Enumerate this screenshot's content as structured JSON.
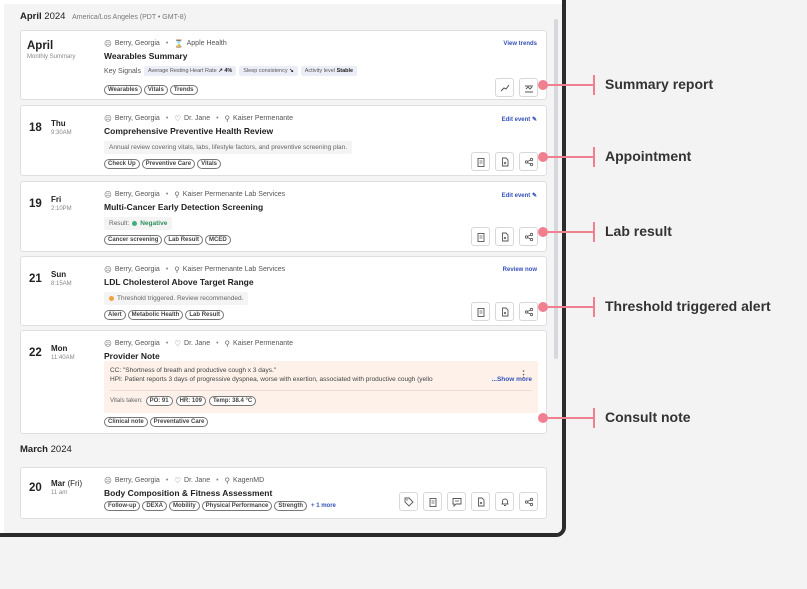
{
  "timezone": "America/Los Angeles (PDT • GMT-8)",
  "months": [
    {
      "name": "April",
      "year": "2024"
    },
    {
      "name": "March",
      "year": "2024"
    }
  ],
  "summary": {
    "month": "April",
    "subtitle": "Monthly Summary",
    "patient": "Berry, Georgia",
    "source": "Apple Health",
    "title": "Wearables Summary",
    "action": "View trends",
    "signals_label": "Key Signals",
    "signals": [
      {
        "label": "Average Resting Heart Rate",
        "value": "4%",
        "trend": "up"
      },
      {
        "label": "Sleep consistency",
        "value": "",
        "trend": "down"
      },
      {
        "label": "Activity level",
        "value": "Stable",
        "trend": "none"
      }
    ],
    "tags": [
      "Wearables",
      "Vitals",
      "Trends"
    ]
  },
  "appointment": {
    "day": "18",
    "weekday": "Thu",
    "time": "9:30AM",
    "patient": "Berry, Georgia",
    "provider": "Dr. Jane",
    "location": "Kaiser Permenante",
    "title": "Comprehensive Preventive Health Review",
    "description": "Annual review covering vitals, labs, lifestyle factors, and preventive screening plan.",
    "action": "Edit event",
    "tags": [
      "Check Up",
      "Preventive Care",
      "Vitals"
    ]
  },
  "lab": {
    "day": "19",
    "weekday": "Fri",
    "time": "2:10PM",
    "patient": "Berry, Georgia",
    "location": "Kaiser Permenante Lab Services",
    "title": "Multi-Cancer Early Detection Screening",
    "result_label": "Result:",
    "result_value": "Negative",
    "action": "Edit event",
    "tags": [
      "Cancer screening",
      "Lab Result",
      "MCED"
    ]
  },
  "alert": {
    "day": "21",
    "weekday": "Sun",
    "time": "8:15AM",
    "patient": "Berry, Georgia",
    "location": "Kaiser Permenante Lab Services",
    "title": "LDL Cholesterol Above Target Range",
    "status": "Threshold triggered. Review recommended.",
    "action": "Review now",
    "tags": [
      "Alert",
      "Metabolic Health",
      "Lab Result"
    ]
  },
  "consult": {
    "day": "22",
    "weekday": "Mon",
    "time": "11:40AM",
    "patient": "Berry, Georgia",
    "provider": "Dr. Jane",
    "location": "Kaiser Permenante",
    "title": "Provider Note",
    "cc": "CC: \"Shortness of breath and productive cough x 3 days.\"",
    "hpi": "HPI: Patient reports 3 days of progressive dyspnea, worse with exertion, associated with productive cough (yello",
    "show_more": "...Show more",
    "vitals_label": "Vitals taken:",
    "vitals": [
      "PO: 91",
      "HR: 109",
      "Temp: 38.4 °C"
    ],
    "tags": [
      "Clinical note",
      "Preventative Care"
    ]
  },
  "march_event": {
    "day": "20",
    "weekday": "Mar",
    "weekday_suffix": "(Fri)",
    "time": "11 am",
    "patient": "Berry, Georgia",
    "provider": "Dr. Jane",
    "location": "KagenMD",
    "title": "Body Composition & Fitness Assessment",
    "tags": [
      "Follow-up",
      "DEXA",
      "Mobility",
      "Physical Performance",
      "Strength"
    ],
    "more_tags": "+ 1 more"
  },
  "callouts": [
    "Summary report",
    "Appointment",
    "Lab result",
    "Threshold triggered alert",
    "Consult note"
  ],
  "colors": {
    "accent": "#3552b8",
    "callout": "#f08090",
    "note_bg": "#fdf1ea",
    "positive": "#3fae7d",
    "warning": "#f0a23c"
  }
}
